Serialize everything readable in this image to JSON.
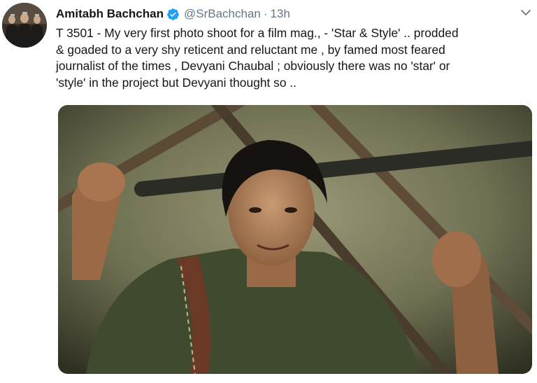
{
  "tweet": {
    "author_name": "Amitabh Bachchan",
    "handle": "@SrBachchan",
    "separator": "·",
    "timestamp": "13h",
    "text_lines": [
      "T 3501 - My very first photo shoot for a film mag., - 'Star & Style' .. prodded",
      "& goaded to a very shy reticent and reluctant me , by famed most feared",
      "journalist of the times , Devyani Chaubal ; obviously there was no 'star' or",
      "'style' in the project but Devyani thought so .."
    ]
  },
  "icons": {
    "verified": "verified-badge-icon",
    "menu": "chevron-down-icon"
  },
  "colors": {
    "verified_blue": "#1da1f2",
    "secondary_text": "#657786",
    "primary_text": "#14171a"
  }
}
